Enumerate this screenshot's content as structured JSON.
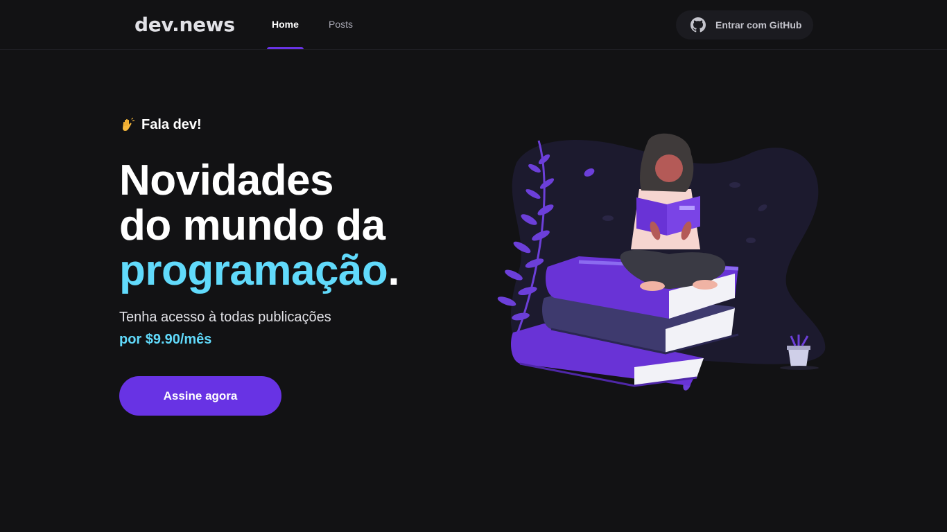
{
  "header": {
    "logo": "dev.news",
    "nav": [
      {
        "label": "Home",
        "active": true
      },
      {
        "label": "Posts",
        "active": false
      }
    ],
    "signin_label": "Entrar com GitHub",
    "signin_icon": "github-icon"
  },
  "hero": {
    "greeting_icon": "waving-hand-icon",
    "greeting": "Fala dev!",
    "headline_line1": "Novidades",
    "headline_line2": "do mundo da",
    "headline_accent": "programação",
    "headline_end": ".",
    "subtitle": "Tenha acesso à todas publicações",
    "price": "por $9.90/mês",
    "cta_label": "Assine agora",
    "illustration": "woman-reading-on-books-illustration"
  },
  "colors": {
    "background": "#121214",
    "primary": "#6833e4",
    "accent": "#61dafb",
    "text": "#e1e1e6",
    "muted": "#a8a8b3"
  }
}
